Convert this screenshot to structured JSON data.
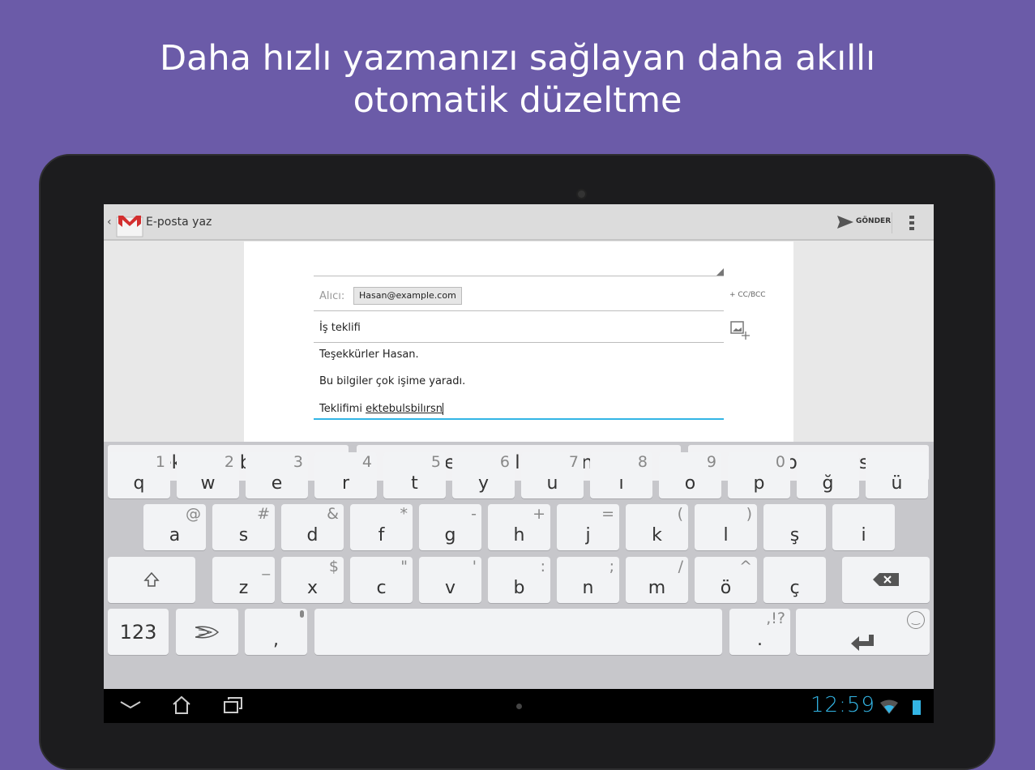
{
  "headline": [
    "Daha hızlı yazmanızı sağlayan daha akıllı",
    "otomatik düzeltme"
  ],
  "actionbar": {
    "title": "E-posta yaz",
    "send": "GÖNDER"
  },
  "compose": {
    "to_label": "Alıcı:",
    "to_chip": "Hasan@example.com",
    "cc_bcc": "+ CC/BCC",
    "subject": "İş teklifi",
    "body": [
      "Teşekkürler Hasan.",
      "Bu bilgiler çok işime yaradı."
    ],
    "typing_prefix": "Teklifimi ",
    "typing_word": "ektebulsbilırsn"
  },
  "suggestions": [
    "ektebulsbilırsn",
    "ekte bulabilirsin",
    "wkgebulsbilırsn"
  ],
  "rows": [
    [
      [
        "q",
        "1"
      ],
      [
        "w",
        "2"
      ],
      [
        "e",
        "3"
      ],
      [
        "r",
        "4"
      ],
      [
        "t",
        "5"
      ],
      [
        "y",
        "6"
      ],
      [
        "u",
        "7"
      ],
      [
        "ı",
        "8"
      ],
      [
        "o",
        "9"
      ],
      [
        "p",
        "0"
      ],
      [
        "ğ",
        ""
      ],
      [
        "ü",
        ""
      ]
    ],
    [
      [
        "a",
        "@"
      ],
      [
        "s",
        "#"
      ],
      [
        "d",
        "&"
      ],
      [
        "f",
        "*"
      ],
      [
        "g",
        "-"
      ],
      [
        "h",
        "+"
      ],
      [
        "j",
        "="
      ],
      [
        "k",
        "("
      ],
      [
        "l",
        ")"
      ],
      [
        "ş",
        ""
      ],
      [
        "i",
        ""
      ]
    ],
    [
      [
        "z",
        "_"
      ],
      [
        "x",
        "$"
      ],
      [
        "c",
        "\""
      ],
      [
        "v",
        "'"
      ],
      [
        "b",
        ":"
      ],
      [
        "n",
        ";"
      ],
      [
        "m",
        "/"
      ],
      [
        "ö",
        "^"
      ],
      [
        "ç",
        ""
      ]
    ]
  ],
  "bottom": {
    "num": "123",
    "comma": ",",
    "period": ".",
    "period_alt": ",!?"
  },
  "status": {
    "time": "12:59"
  },
  "colors": {
    "accent": "#33b5e5",
    "background": "#6b5ba8"
  }
}
